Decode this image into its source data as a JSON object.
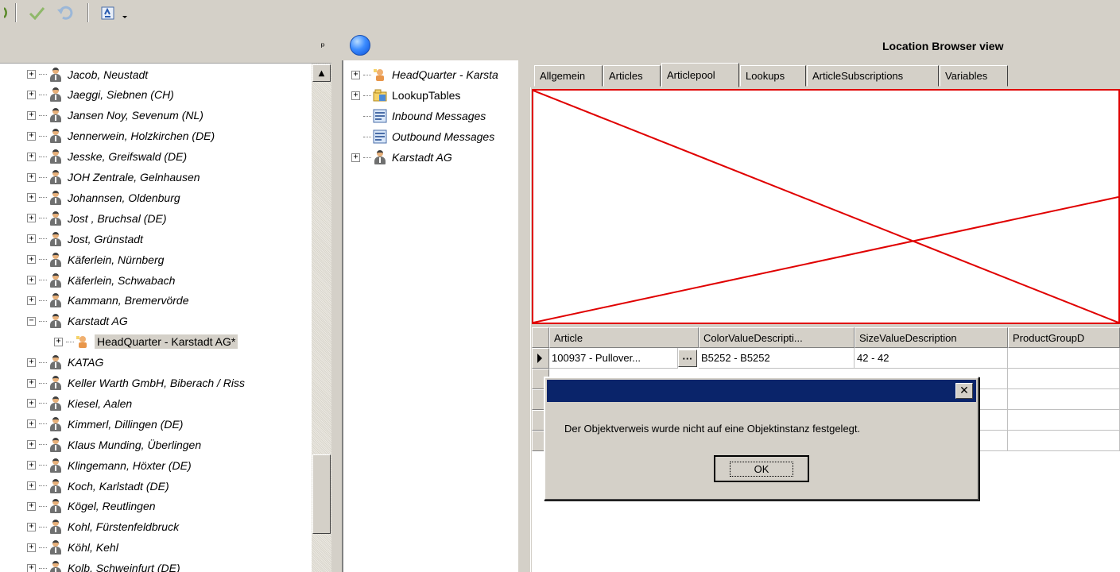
{
  "toolbar": {
    "icons": [
      "refresh-icon",
      "check-icon",
      "undo-icon",
      "sync-icon",
      "dropdown-icon"
    ]
  },
  "left_panel": {
    "pin_glyph": "ᵖ",
    "items": [
      {
        "label": "Jacob, Neustadt",
        "icon": "person-icon"
      },
      {
        "label": "Jaeggi, Siebnen (CH)",
        "icon": "person-icon"
      },
      {
        "label": "Jansen Noy, Sevenum (NL)",
        "icon": "person-icon"
      },
      {
        "label": "Jennerwein, Holzkirchen (DE)",
        "icon": "person-icon"
      },
      {
        "label": "Jesske, Greifswald (DE)",
        "icon": "person-icon"
      },
      {
        "label": "JOH Zentrale, Gelnhausen",
        "icon": "person-icon"
      },
      {
        "label": "Johannsen, Oldenburg",
        "icon": "person-icon"
      },
      {
        "label": "Jost , Bruchsal (DE)",
        "icon": "person-icon"
      },
      {
        "label": "Jost, Grünstadt",
        "icon": "person-icon"
      },
      {
        "label": "Käferlein, Nürnberg",
        "icon": "person-icon"
      },
      {
        "label": "Käferlein, Schwabach",
        "icon": "person-icon"
      },
      {
        "label": "Kammann, Bremervörde",
        "icon": "person-icon"
      },
      {
        "label": "Karstadt AG",
        "icon": "person-icon",
        "expanded": true
      },
      {
        "label": "HeadQuarter - Karstadt AG*",
        "icon": "headquarter-icon",
        "child": true,
        "selected": true
      },
      {
        "label": "KATAG",
        "icon": "person-icon"
      },
      {
        "label": "Keller Warth GmbH, Biberach / Riss",
        "icon": "person-icon"
      },
      {
        "label": "Kiesel, Aalen",
        "icon": "person-icon"
      },
      {
        "label": "Kimmerl, Dillingen (DE)",
        "icon": "person-icon"
      },
      {
        "label": "Klaus Munding, Überlingen",
        "icon": "person-icon"
      },
      {
        "label": "Klingemann, Höxter (DE)",
        "icon": "person-icon"
      },
      {
        "label": "Koch, Karlstadt (DE)",
        "icon": "person-icon"
      },
      {
        "label": "Kögel, Reutlingen",
        "icon": "person-icon"
      },
      {
        "label": "Kohl, Fürstenfeldbruck",
        "icon": "person-icon"
      },
      {
        "label": "Köhl, Kehl",
        "icon": "person-icon"
      },
      {
        "label": "Kolb, Schweinfurt (DE)",
        "icon": "person-icon"
      }
    ]
  },
  "view": {
    "title": "Location Browser view"
  },
  "middle_tree": {
    "items": [
      {
        "label": "HeadQuarter - Karsta",
        "italic": true
      },
      {
        "label": "LookupTables",
        "italic": false
      },
      {
        "label": "Inbound Messages",
        "italic": true
      },
      {
        "label": "Outbound Messages",
        "italic": true
      },
      {
        "label": "Karstadt AG",
        "italic": true
      }
    ]
  },
  "tabs": [
    {
      "label": "Allgemein"
    },
    {
      "label": "Articles"
    },
    {
      "label": "Articlepool",
      "active": true
    },
    {
      "label": "Lookups"
    },
    {
      "label": "ArticleSubscriptions"
    },
    {
      "label": "Variables"
    }
  ],
  "grid": {
    "columns": [
      "Article",
      "ColorValueDescripti...",
      "SizeValueDescription",
      "ProductGroupD"
    ],
    "rows": [
      {
        "article": "100937  -  Pullover...",
        "ellipsis": "···",
        "color": "B5252 - B5252",
        "size": "42 - 42",
        "group": ""
      }
    ]
  },
  "dialog": {
    "message": "Der Objektverweis wurde nicht auf eine Objektinstanz festgelegt.",
    "ok_label": "OK",
    "close_glyph": "✕"
  },
  "colors": {
    "dialog_titlebar": "#0a246a",
    "error_box": "#e00000",
    "window_bg": "#d4d0c8"
  }
}
